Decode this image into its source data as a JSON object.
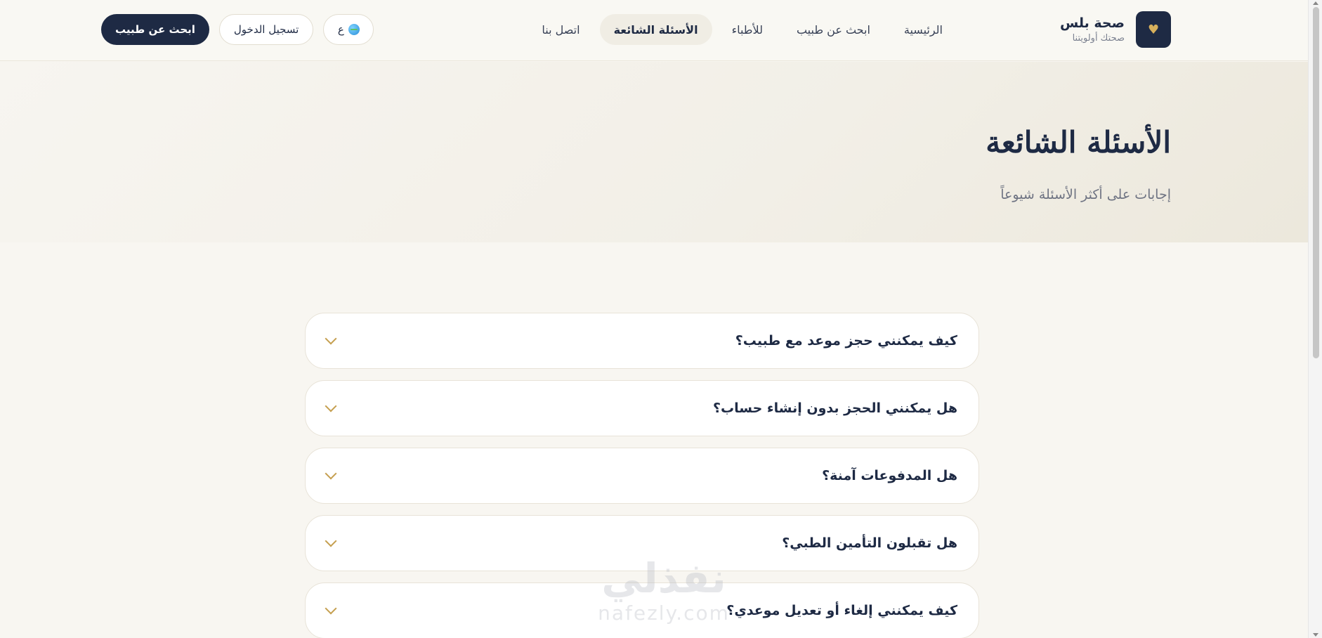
{
  "brand": {
    "name": "صحة بلس",
    "tagline": "صحتك أولويتنا",
    "logo_icon": "heart-icon"
  },
  "nav": {
    "items": [
      {
        "label": "الرئيسية",
        "active": false
      },
      {
        "label": "ابحث عن طبيب",
        "active": false
      },
      {
        "label": "للأطباء",
        "active": false
      },
      {
        "label": "الأسئلة الشائعة",
        "active": true
      },
      {
        "label": "اتصل بنا",
        "active": false
      }
    ]
  },
  "actions": {
    "language_label": "ع",
    "language_icon": "globe-icon",
    "login_label": "تسجيل الدخول",
    "cta_label": "ابحث عن طبيب"
  },
  "hero": {
    "title": "الأسئلة الشائعة",
    "subtitle": "إجابات على أكثر الأسئلة شيوعاً"
  },
  "faq": {
    "items": [
      {
        "question": "كيف يمكنني حجز موعد مع طبيب؟",
        "icon": "chevron-down-icon"
      },
      {
        "question": "هل يمكنني الحجز بدون إنشاء حساب؟",
        "icon": "chevron-down-icon"
      },
      {
        "question": "هل المدفوعات آمنة؟",
        "icon": "chevron-down-icon"
      },
      {
        "question": "هل تقبلون التأمين الطبي؟",
        "icon": "chevron-down-icon"
      },
      {
        "question": "كيف يمكنني إلغاء أو تعديل موعدي؟",
        "icon": "chevron-down-icon"
      }
    ]
  },
  "watermark": {
    "arabic": "نفذلي",
    "latin": "nafezly.com"
  },
  "colors": {
    "navy": "#1e2a44",
    "gold_accent": "#c59f4f",
    "background": "#f8f6f1"
  }
}
